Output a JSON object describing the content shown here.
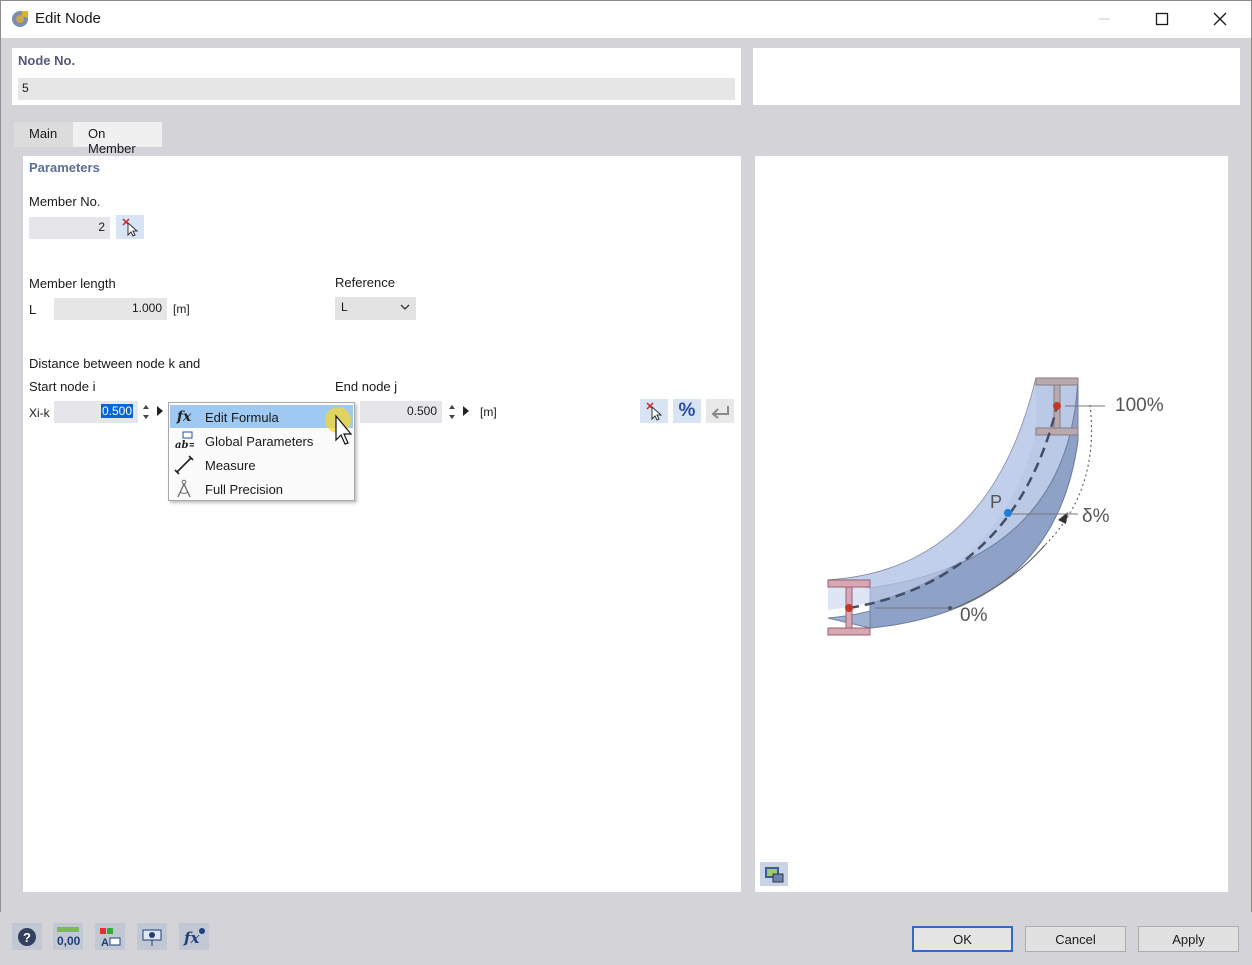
{
  "window": {
    "title": "Edit Node"
  },
  "node": {
    "label": "Node No.",
    "value": "5"
  },
  "tabs": [
    {
      "label": "Main"
    },
    {
      "label": "On Member"
    }
  ],
  "parameters": {
    "title": "Parameters",
    "member_no_label": "Member No.",
    "member_no_value": "2",
    "member_length_label": "Member length",
    "length_symbol": "L",
    "length_value": "1.000",
    "length_unit": "[m]",
    "reference_label": "Reference",
    "reference_value": "L",
    "distance_label": "Distance between node k and",
    "start_node_label": "Start node i",
    "start_symbol": "Xi-k",
    "start_value": "0.500",
    "end_node_label": "End node j",
    "end_value": "0.500",
    "end_unit": "[m]"
  },
  "context_menu": {
    "items": [
      {
        "label": "Edit Formula",
        "icon": "fx-icon"
      },
      {
        "label": "Global Parameters",
        "icon": "global-parameters-icon"
      },
      {
        "label": "Measure",
        "icon": "measure-icon"
      },
      {
        "label": "Full Precision",
        "icon": "full-precision-icon"
      }
    ]
  },
  "diagram": {
    "label_100": "100%",
    "label_delta": "δ%",
    "label_0": "0%",
    "label_p": "P"
  },
  "buttons": {
    "ok": "OK",
    "cancel": "Cancel",
    "apply": "Apply"
  },
  "colors": {
    "accent": "#2f6cc8",
    "menu_highlight": "#9ec9f2",
    "section_title": "#5b6d95"
  }
}
